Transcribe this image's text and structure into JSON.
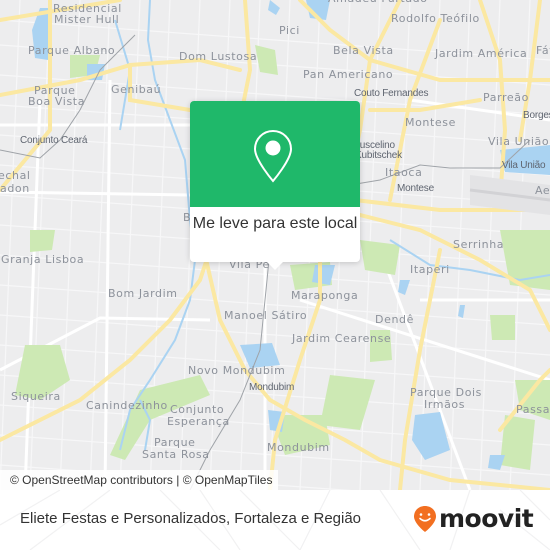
{
  "map": {
    "neighborhoods": [
      {
        "name": "Residencial",
        "style": "area"
      },
      {
        "name": "Mister Hull",
        "style": "area"
      },
      {
        "name": "Parque Albano",
        "style": "area"
      },
      {
        "name": "Parque",
        "style": "area"
      },
      {
        "name": "Boa Vista",
        "style": "area"
      },
      {
        "name": "Genibaú",
        "style": "area"
      },
      {
        "name": "Conjunto Ceará",
        "style": "place"
      },
      {
        "name": "echal",
        "style": "area"
      },
      {
        "name": "adon",
        "style": "area"
      },
      {
        "name": "Granja Lisboa",
        "style": "area"
      },
      {
        "name": "Bom Jardim",
        "style": "area"
      },
      {
        "name": "Siqueira",
        "style": "area"
      },
      {
        "name": "Canindezinho",
        "style": "area"
      },
      {
        "name": "Conjunto",
        "style": "area"
      },
      {
        "name": "Esperança",
        "style": "area"
      },
      {
        "name": "Parque",
        "style": "area"
      },
      {
        "name": "Santa Rosa",
        "style": "area"
      },
      {
        "name": "Dom Lustosa",
        "style": "area"
      },
      {
        "name": "Pici",
        "style": "area"
      },
      {
        "name": "Bela Vista",
        "style": "area"
      },
      {
        "name": "Pan Americano",
        "style": "area"
      },
      {
        "name": "Amadeu Furtado",
        "style": "area"
      },
      {
        "name": "Rodolfo Teófilo",
        "style": "area"
      },
      {
        "name": "Jardim América",
        "style": "area"
      },
      {
        "name": "Fát",
        "style": "area"
      },
      {
        "name": "Couto Fernandes",
        "style": "place"
      },
      {
        "name": "Parreão",
        "style": "area"
      },
      {
        "name": "Borges",
        "style": "place"
      },
      {
        "name": "Montese",
        "style": "area"
      },
      {
        "name": "Vila União",
        "style": "area"
      },
      {
        "name": "Vila União",
        "style": "place"
      },
      {
        "name": "Juscelino",
        "style": "place"
      },
      {
        "name": "Kubitschek",
        "style": "place"
      },
      {
        "name": "Itaoca",
        "style": "area"
      },
      {
        "name": "Montese",
        "style": "place"
      },
      {
        "name": "Aer",
        "style": "area"
      },
      {
        "name": "Serrinha",
        "style": "area"
      },
      {
        "name": "Itaperi",
        "style": "area"
      },
      {
        "name": "Vila Pe",
        "style": "area"
      },
      {
        "name": "Maraponga",
        "style": "area"
      },
      {
        "name": "Manoel Sátiro",
        "style": "area"
      },
      {
        "name": "Dendê",
        "style": "area"
      },
      {
        "name": "Jardim Cearense",
        "style": "area"
      },
      {
        "name": "Novo Mondubim",
        "style": "area"
      },
      {
        "name": "Mondubim",
        "style": "place"
      },
      {
        "name": "Parque Dois",
        "style": "area"
      },
      {
        "name": "Irmãos",
        "style": "area"
      },
      {
        "name": "Passar",
        "style": "area"
      },
      {
        "name": "Mondubim",
        "style": "area"
      },
      {
        "name": "B",
        "style": "area"
      }
    ],
    "colors": {
      "land": "#ededee",
      "road_major": "#fbe8a2",
      "road_minor": "#ffffff",
      "water": "#aad3f2",
      "park": "#cde9b4",
      "brand_green": "#1fb86a",
      "brand_orange": "#f26f21"
    }
  },
  "popup": {
    "icon": "map-pin-icon",
    "label": "Me leve para este local"
  },
  "attribution": {
    "text": "© OpenStreetMap contributors | © OpenMapTiles"
  },
  "footer": {
    "title": "Eliete Festas e Personalizados, Fortaleza e Região",
    "logo_text": "moovit",
    "logo_icon": "moovit-smile-pin-icon"
  }
}
